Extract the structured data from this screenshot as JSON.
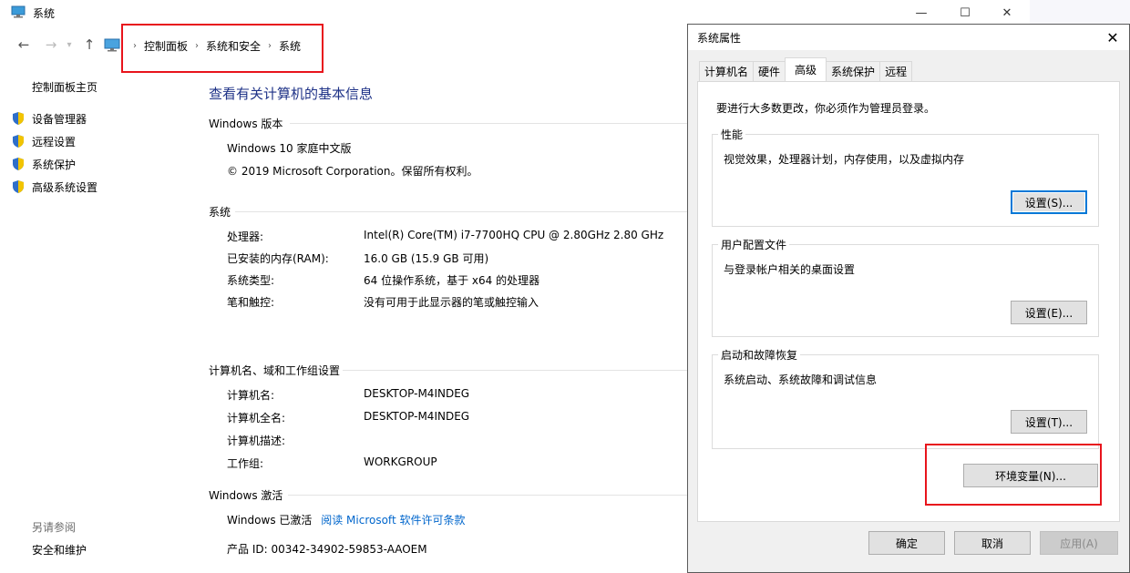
{
  "window": {
    "title": "系统",
    "controls": {
      "minimize": "—",
      "maximize": "☐",
      "close": "✕"
    }
  },
  "nav": {
    "back": "←",
    "forward": "→",
    "up": "↑",
    "breadcrumb": [
      "控制面板",
      "系统和安全",
      "系统"
    ],
    "separator": "›"
  },
  "left_pane": {
    "home": "控制面板主页",
    "items": [
      {
        "label": "设备管理器",
        "icon": "shield-icon"
      },
      {
        "label": "远程设置",
        "icon": "shield-icon"
      },
      {
        "label": "系统保护",
        "icon": "shield-icon"
      },
      {
        "label": "高级系统设置",
        "icon": "shield-icon"
      }
    ],
    "see_also": "另请参阅",
    "security": "安全和维护"
  },
  "main": {
    "title": "查看有关计算机的基本信息",
    "edition": {
      "heading": "Windows 版本",
      "name": "Windows 10 家庭中文版",
      "copyright": "© 2019 Microsoft Corporation。保留所有权利。"
    },
    "system": {
      "heading": "系统",
      "rows": [
        {
          "label": "处理器:",
          "value": "Intel(R) Core(TM) i7-7700HQ CPU @ 2.80GHz   2.80 GHz"
        },
        {
          "label": "已安装的内存(RAM):",
          "value": "16.0 GB (15.9 GB 可用)"
        },
        {
          "label": "系统类型:",
          "value": "64 位操作系统，基于 x64 的处理器"
        },
        {
          "label": "笔和触控:",
          "value": "没有可用于此显示器的笔或触控输入"
        }
      ]
    },
    "computer": {
      "heading": "计算机名、域和工作组设置",
      "rows": [
        {
          "label": "计算机名:",
          "value": "DESKTOP-M4INDEG"
        },
        {
          "label": "计算机全名:",
          "value": "DESKTOP-M4INDEG"
        },
        {
          "label": "计算机描述:",
          "value": ""
        },
        {
          "label": "工作组:",
          "value": "WORKGROUP"
        }
      ]
    },
    "activation": {
      "heading": "Windows 激活",
      "status": "Windows 已激活",
      "license_link": "阅读 Microsoft 软件许可条款",
      "product_id": "产品 ID: 00342-34902-59853-AAOEM"
    }
  },
  "dialog": {
    "title": "系统属性",
    "close": "✕",
    "tabs": [
      "计算机名",
      "硬件",
      "高级",
      "系统保护",
      "远程"
    ],
    "active_tab": "高级",
    "admin_note": "要进行大多数更改，你必须作为管理员登录。",
    "performance": {
      "legend": "性能",
      "desc": "视觉效果，处理器计划，内存使用，以及虚拟内存",
      "button": "设置(S)..."
    },
    "profiles": {
      "legend": "用户配置文件",
      "desc": "与登录帐户相关的桌面设置",
      "button": "设置(E)..."
    },
    "startup": {
      "legend": "启动和故障恢复",
      "desc": "系统启动、系统故障和调试信息",
      "button": "设置(T)..."
    },
    "env_button": "环境变量(N)...",
    "ok": "确定",
    "cancel": "取消",
    "apply": "应用(A)"
  },
  "colors": {
    "annotation": "#e8141c",
    "title_blue": "#1e3287",
    "link_blue": "#0066cc",
    "focus_blue": "#0078d7"
  }
}
